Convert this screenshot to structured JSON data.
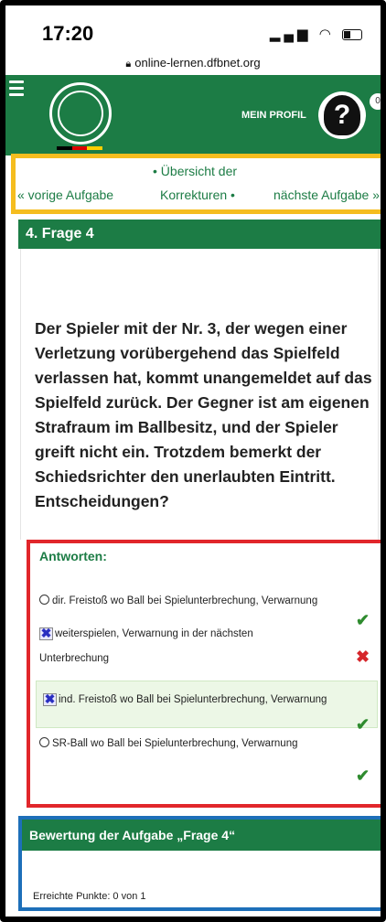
{
  "status_bar": {
    "time": "17:20",
    "url": "online-lernen.dfbnet.org",
    "signal_icon": "signal-icon",
    "wifi_icon": "wifi-icon",
    "battery_icon": "battery-icon"
  },
  "header": {
    "profile_label": "MEIN PROFIL",
    "notification_count": "0",
    "brand_color": "#1c7c45",
    "flag_colors": [
      "#000000",
      "#dd0000",
      "#ffce00"
    ]
  },
  "nav": {
    "prev": "« vorige Aufgabe",
    "overview_line1": "• Übersicht der",
    "overview_line2": "Korrekturen •",
    "next": "nächste Aufgabe »"
  },
  "question": {
    "heading": "4. Frage 4",
    "text": "Der Spieler mit der Nr. 3, der wegen einer Verletzung vorübergehend das Spielfeld verlassen hat, kommt unangemeldet auf das Spielfeld zurück. Der Gegner ist am eigenen Strafraum im Ballbesitz, und der Spieler greift nicht ein. Trotzdem bemerkt der Schiedsrichter den unerlaubten Eintritt. Entscheidungen?"
  },
  "answers": {
    "title": "Antworten:",
    "items": [
      {
        "label": "dir. Freistoß wo Ball bei Spielunterbrechung, Verwarnung",
        "selected": false,
        "result": "correct"
      },
      {
        "label_line1": "weiterspielen, Verwarnung in der nächsten",
        "label_line2": "Unterbrechung",
        "selected": true,
        "result": "wrong"
      },
      {
        "label": "ind. Freistoß wo Ball bei Spielunterbrechung, Verwarnung",
        "selected": true,
        "result": "correct"
      },
      {
        "label": "SR-Ball wo Ball bei Spielunterbrechung, Verwarnung",
        "selected": false,
        "result": "correct"
      }
    ],
    "check_symbol": "✔",
    "cross_symbol": "✖",
    "selected_symbol": "✖"
  },
  "rating": {
    "heading": "Bewertung der Aufgabe „Frage 4“",
    "points": "Erreichte Punkte: 0 von 1"
  }
}
